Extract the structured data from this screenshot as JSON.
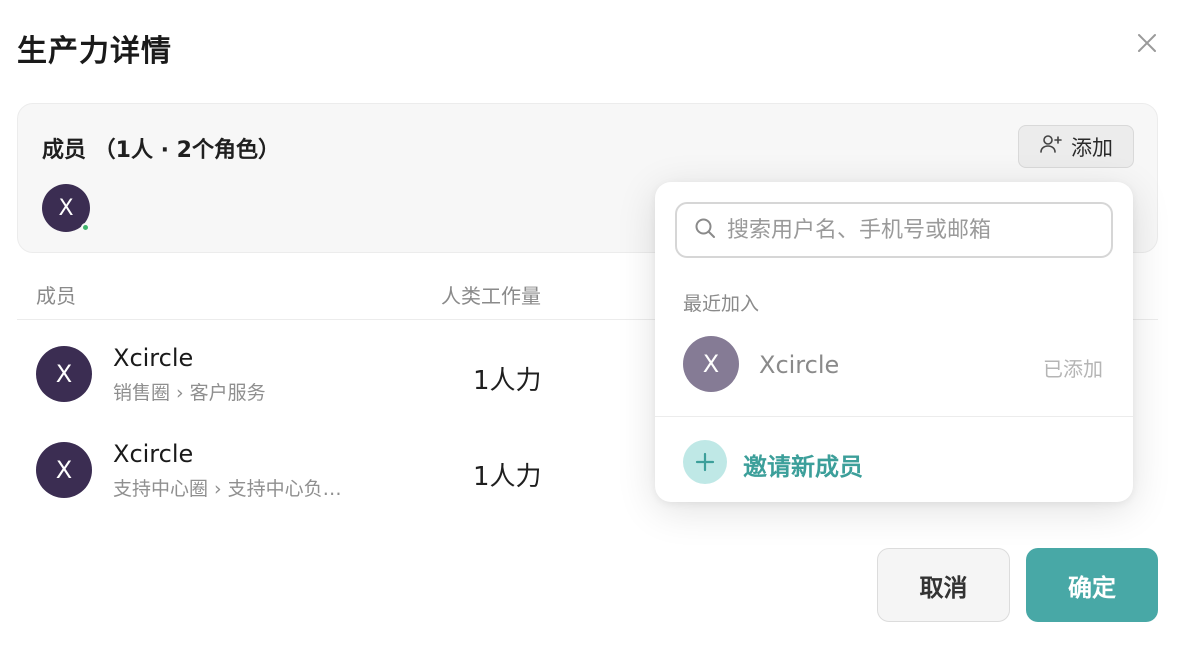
{
  "dialog": {
    "title": "生产力详情",
    "close_icon": "close-icon"
  },
  "members_card": {
    "heading": "成员 （1人 · 2个角色）",
    "add_label": "添加",
    "add_icon": "user-plus-icon",
    "avatar_initial": "X",
    "online_status_color": "#3fb36c"
  },
  "table": {
    "columns": [
      "成员",
      "人类工作量"
    ],
    "rows": [
      {
        "initial": "X",
        "name": "Xcircle",
        "path": "销售圈 › 客户服务",
        "workload": "1人力"
      },
      {
        "initial": "X",
        "name": "Xcircle",
        "path": "支持中心圈 › 支持中心负…",
        "workload": "1人力"
      }
    ]
  },
  "popover": {
    "search_placeholder": "搜索用户名、手机号或邮箱",
    "search_icon": "search-icon",
    "recent_label": "最近加入",
    "recent_user": {
      "initial": "X",
      "name": "Xcircle",
      "status": "已添加"
    },
    "invite_label": "邀请新成员",
    "invite_icon": "plus-icon"
  },
  "footer": {
    "cancel_label": "取消",
    "confirm_label": "确定"
  },
  "colors": {
    "accent": "#48a8a6",
    "avatar": "#3b2d52",
    "invite_text": "#3c9f9a"
  }
}
